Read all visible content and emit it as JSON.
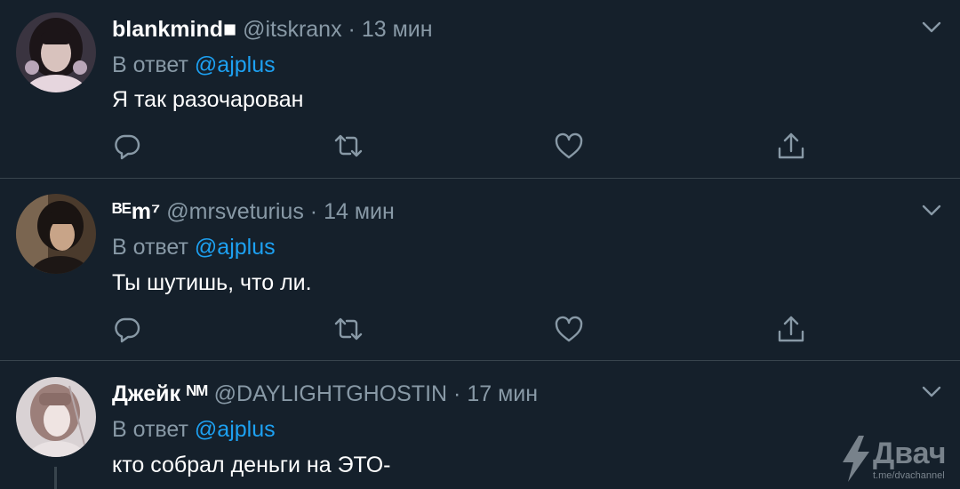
{
  "colors": {
    "background": "#15202b",
    "divider": "#38444d",
    "text_primary": "#ffffff",
    "text_secondary": "#8899a6",
    "link": "#1da1f2"
  },
  "tweets": [
    {
      "display_name": "blankmind■",
      "handle": "@itskranx",
      "separator": "·",
      "time": "13 мин",
      "reply_prefix": "В ответ",
      "reply_to": "@ajplus",
      "text": "Я так разочарован",
      "avatar_icon": "user-avatar"
    },
    {
      "display_name": "ᴮᴱm⁷",
      "handle": "@mrsveturius",
      "separator": "·",
      "time": "14 мин",
      "reply_prefix": "В ответ",
      "reply_to": "@ajplus",
      "text": "Ты шутишь, что ли.",
      "avatar_icon": "user-avatar"
    },
    {
      "display_name": "Джейк ᴺᴹ",
      "handle": "@DAYLIGHTGHOSTIN",
      "separator": "·",
      "time": "17 мин",
      "reply_prefix": "В ответ",
      "reply_to": "@ajplus",
      "text": "кто собрал деньги на ЭТО-",
      "avatar_icon": "user-avatar"
    }
  ],
  "actions": {
    "icons": [
      "reply-icon",
      "retweet-icon",
      "like-icon",
      "share-icon"
    ],
    "menu_icon": "chevron-down-icon"
  },
  "watermark": {
    "name": "Двач",
    "url": "t.me/dvachannel",
    "icon": "lightning-bolt-icon"
  }
}
